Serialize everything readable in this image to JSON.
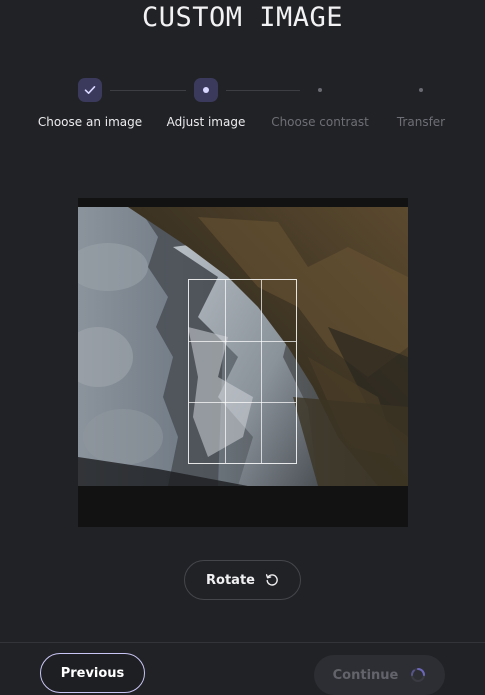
{
  "page": {
    "title": "CUSTOM IMAGE"
  },
  "stepper": {
    "steps": [
      {
        "label": "Choose an image",
        "state": "done"
      },
      {
        "label": "Adjust image",
        "state": "active"
      },
      {
        "label": "Choose contrast",
        "state": "pending"
      },
      {
        "label": "Transfer",
        "state": "pending"
      }
    ]
  },
  "editor": {
    "image_desc_icon": "mountain-photo",
    "rotate_label": "Rotate",
    "rotate_icon": "rotate-ccw-icon"
  },
  "footer": {
    "previous_label": "Previous",
    "continue_label": "Continue",
    "continue_state": "loading"
  },
  "colors": {
    "background": "#212225",
    "accent": "#c9c5f5",
    "step_node": "#3b3a5c"
  }
}
